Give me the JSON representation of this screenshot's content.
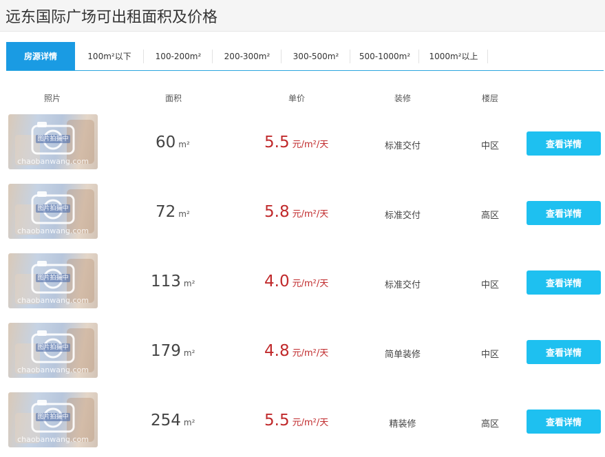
{
  "title": "远东国际广场可出租面积及价格",
  "tabs": [
    {
      "label": "房源详情",
      "active": true
    },
    {
      "label": "100m²以下"
    },
    {
      "label": "100-200m²"
    },
    {
      "label": "200-300m²"
    },
    {
      "label": "300-500m²"
    },
    {
      "label": "500-1000m²"
    },
    {
      "label": "1000m²以上"
    }
  ],
  "columns": {
    "photo": "照片",
    "area": "面积",
    "price": "单价",
    "decoration": "装修",
    "floor": "楼层"
  },
  "thumb_watermark": "chaobanwang.com",
  "thumb_badge": "图片拍摄中",
  "area_unit": "m²",
  "price_unit": "元/m²/天",
  "button_label": "查看详情",
  "listings": [
    {
      "area": "60",
      "price": "5.5",
      "decoration": "标准交付",
      "floor": "中区"
    },
    {
      "area": "72",
      "price": "5.8",
      "decoration": "标准交付",
      "floor": "高区"
    },
    {
      "area": "113",
      "price": "4.0",
      "decoration": "标准交付",
      "floor": "中区"
    },
    {
      "area": "179",
      "price": "4.8",
      "decoration": "简单装修",
      "floor": "中区"
    },
    {
      "area": "254",
      "price": "5.5",
      "decoration": "精装修",
      "floor": "高区"
    }
  ],
  "colors": {
    "tab_active_bg": "#1a9be3",
    "price": "#c0292b",
    "button_bg": "#1ec0f0"
  }
}
